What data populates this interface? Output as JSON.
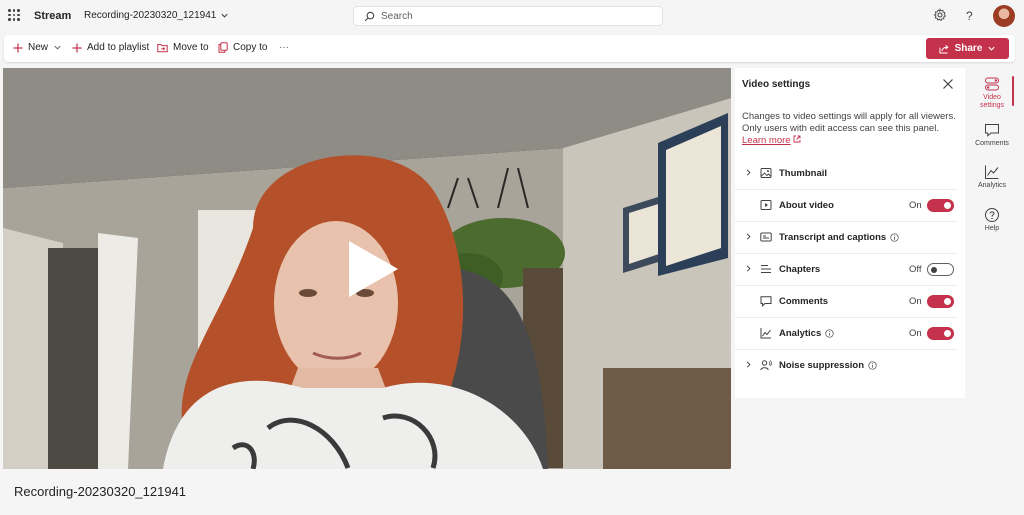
{
  "app": {
    "name": "Stream",
    "file_name": "Recording-20230320_121941"
  },
  "search": {
    "placeholder": "Search"
  },
  "toolbar": {
    "new_label": "New",
    "add_to_playlist_label": "Add to playlist",
    "move_to_label": "Move to",
    "copy_to_label": "Copy to",
    "more_label": "···",
    "share_label": "Share"
  },
  "panel": {
    "title": "Video settings",
    "description": "Changes to video settings will apply for all viewers. Only users with edit access can see this panel.",
    "learn_more": "Learn more",
    "settings": [
      {
        "label": "Thumbnail",
        "icon": "image-icon",
        "expandable": true,
        "state": "",
        "toggle": null,
        "info": false
      },
      {
        "label": "About video",
        "icon": "play-box-icon",
        "expandable": false,
        "state": "On",
        "toggle": "on",
        "info": false
      },
      {
        "label": "Transcript and captions",
        "icon": "captions-icon",
        "expandable": true,
        "state": "",
        "toggle": null,
        "info": true
      },
      {
        "label": "Chapters",
        "icon": "list-icon",
        "expandable": true,
        "state": "Off",
        "toggle": "off",
        "info": false
      },
      {
        "label": "Comments",
        "icon": "comment-icon",
        "expandable": false,
        "state": "On",
        "toggle": "on",
        "info": false
      },
      {
        "label": "Analytics",
        "icon": "chart-icon",
        "expandable": false,
        "state": "On",
        "toggle": "on",
        "info": true
      },
      {
        "label": "Noise suppression",
        "icon": "people-audio-icon",
        "expandable": true,
        "state": "",
        "toggle": null,
        "info": true
      }
    ]
  },
  "rail": {
    "items": [
      {
        "label": "Video settings",
        "icon": "settings-toggle-icon",
        "active": true
      },
      {
        "label": "Comments",
        "icon": "comment-icon",
        "active": false
      },
      {
        "label": "Analytics",
        "icon": "chart-icon",
        "active": false
      },
      {
        "label": "Help",
        "icon": "help-icon",
        "active": false
      }
    ]
  },
  "video": {
    "title": "Recording-20230320_121941"
  },
  "colors": {
    "accent": "#c4314b",
    "background": "#f5f5f5"
  }
}
